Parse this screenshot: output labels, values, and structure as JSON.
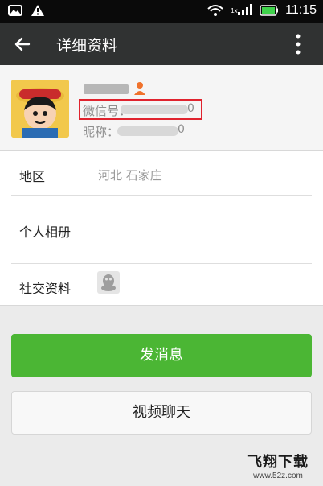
{
  "status_bar": {
    "icons": [
      "image-icon",
      "warning-icon",
      "wifi-icon",
      "signal-icon",
      "battery-icon"
    ],
    "time": "11:15",
    "network_label": "1x"
  },
  "header": {
    "title": "详细资料",
    "back_icon": "back-arrow-icon",
    "more_icon": "more-vertical-icon"
  },
  "profile": {
    "wechat_id_label": "微信号：",
    "wechat_id_tail": "0",
    "nickname_label": "昵称：",
    "nickname_tail": "0"
  },
  "rows": [
    {
      "label": "地区",
      "value": "河北  石家庄"
    },
    {
      "label": "个人相册",
      "value": ""
    },
    {
      "label": "社交资料",
      "value": ""
    }
  ],
  "actions": {
    "send_message": "发消息",
    "video_chat": "视频聊天"
  },
  "watermark": {
    "title": "飞翔下载",
    "url": "www.52z.com"
  },
  "colors": {
    "status_bar": "#0a0a0a",
    "nav_bar": "#303232",
    "primary_button": "#4bb634",
    "highlight_border": "#e0232e"
  }
}
